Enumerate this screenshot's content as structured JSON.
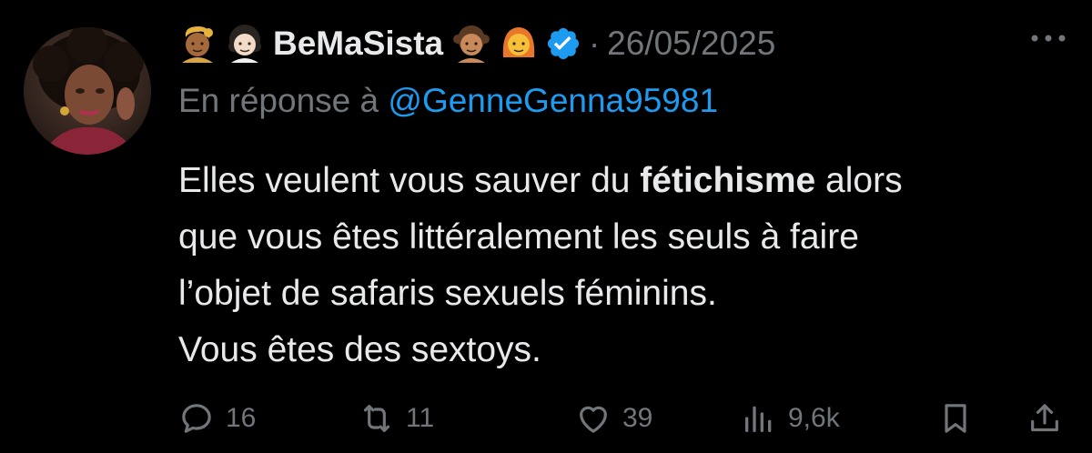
{
  "tweet": {
    "author_name": "BeMaSista",
    "date": "26/05/2025",
    "separator": "·",
    "reply_prefix": "En réponse à ",
    "reply_handle": "@GenneGenna95981",
    "body_lines": [
      [
        "Elles veulent vous sauver du ",
        "fétichisme",
        " alors"
      ],
      [
        "que vous êtes littéralement les seuls à faire"
      ],
      [
        "l’objet de safaris sexuels féminins."
      ],
      [
        "Vous êtes des sextoys."
      ]
    ],
    "emojis_before_name": [
      "person-blond-hair-medium-dark-skin-emoji",
      "woman-curly-hair-light-skin-emoji"
    ],
    "emojis_after_name": [
      "girl-medium-skin-emoji",
      "woman-red-hair-emoji"
    ],
    "verified_badge": "verified-badge-icon",
    "verified_color": "#1d9bf0",
    "text_color": "#e7e9ea",
    "muted_color": "#71767b"
  },
  "actions": {
    "replies": "16",
    "retweets": "11",
    "likes": "39",
    "views": "9,6k"
  }
}
